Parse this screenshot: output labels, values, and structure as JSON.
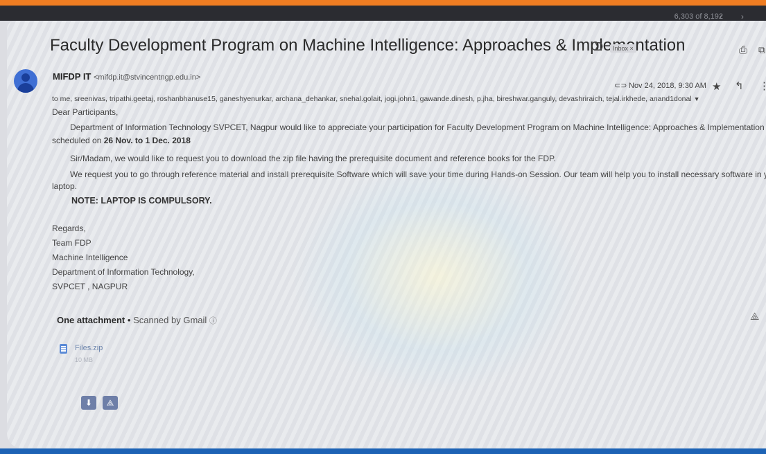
{
  "header": {
    "pager": "6,303 of 8,192",
    "pager_arrows": "‹ ›"
  },
  "email": {
    "subject": "Faculty Development Program on Machine Intelligence: Approaches & Implementation",
    "label": "Inbox ×",
    "sender_name": "MIFDP IT",
    "sender_email": "<mifdp.it@stvincentngp.edu.in>",
    "date": "Nov 24, 2018, 9:30 AM",
    "recipients": "to me, sreenivas, tripathi.geetaj, roshanbhanuse15, ganeshyenurkar, archana_dehankar, snehal.golait, jogi.john1, gawande.dinesh, p.jha, bireshwar.ganguly, devashriraich, tejal.irkhede, anand1donal",
    "body": {
      "greeting": "Dear Participants,",
      "p1_line1": "Department of Information Technology SVPCET, Nagpur would like to appreciate your participation for Faculty Development Program on Machine Intelligence: Approaches & Implementation",
      "p1_line2_pre": "scheduled on ",
      "p1_dates": "26 Nov. to 1 Dec. 2018",
      "p2": "Sir/Madam, we would like to request you to download the zip file having the prerequisite document and reference books for the FDP.",
      "p3_line1": "We request you to go through reference material and install prerequisite Software which will save your time during Hands-on Session. Our team will help you to install necessary software in your",
      "p3_line2": "laptop.",
      "note": "NOTE:  LAPTOP IS COMPULSORY.",
      "signature": [
        "Regards,",
        "Team FDP",
        "Machine Intelligence",
        "Department of Information Technology,",
        "SVPCET , NAGPUR"
      ]
    }
  },
  "attachments": {
    "heading": "One attachment",
    "separator": "•",
    "scanned": "Scanned by Gmail",
    "file_name": "Files.zip",
    "file_size": "10 MB"
  },
  "icons": {
    "important": "important-marker-icon",
    "print": "print-icon",
    "new_window": "new-window-icon",
    "star": "star-icon",
    "reply": "reply-icon",
    "more": "more-vert-icon",
    "download": "download-icon",
    "drive": "add-to-drive-icon"
  },
  "colors": {
    "top_bar": "#ef7d22",
    "avatar": "#3f6fd4",
    "file_icon": "#5b8ad6",
    "bottom_bar": "#1d63b5"
  }
}
